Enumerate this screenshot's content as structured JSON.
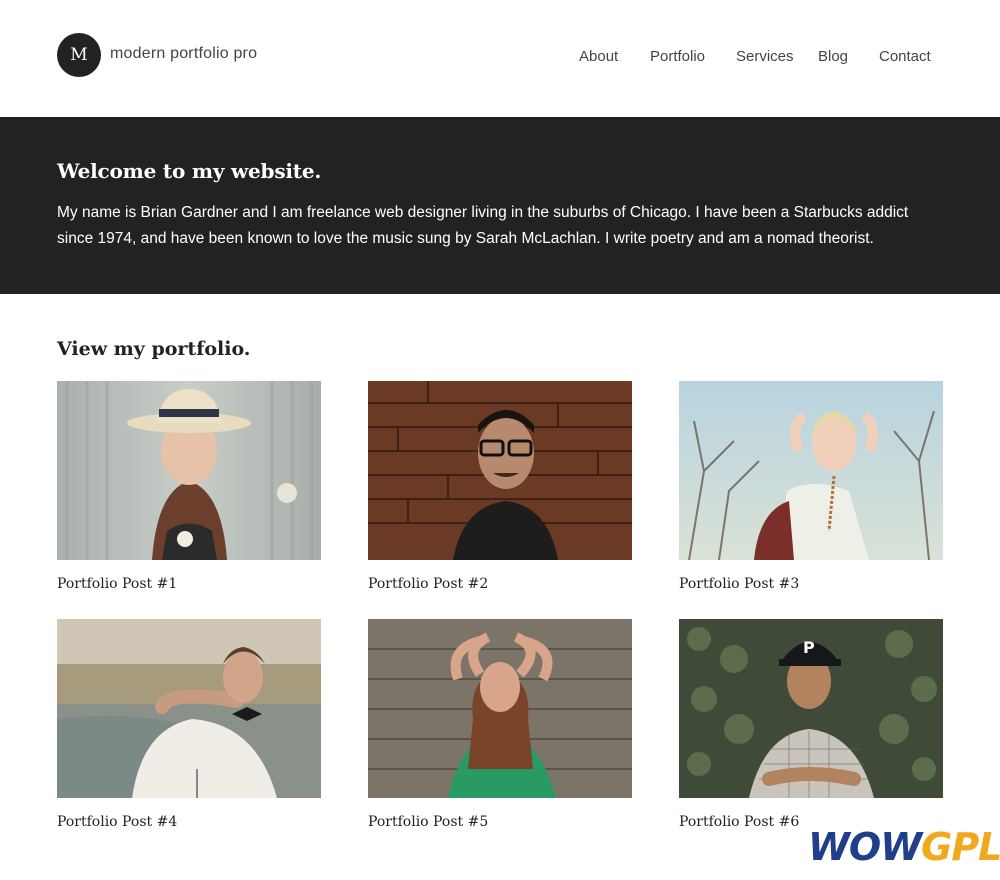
{
  "header": {
    "logo_letter": "M",
    "site_title": "modern portfolio pro",
    "nav": [
      "About",
      "Portfolio",
      "Services",
      "Blog",
      "Contact"
    ]
  },
  "hero": {
    "title": "Welcome to my website.",
    "text": "My name is Brian Gardner and I am freelance web designer living in the suburbs of Chicago. I have been a Starbucks addict since 1974, and have been known to love the music sung by Sarah McLachlan. I write poetry and am a nomad theorist."
  },
  "portfolio": {
    "heading": "View my portfolio.",
    "posts": [
      {
        "title": "Portfolio Post #1"
      },
      {
        "title": "Portfolio Post #2"
      },
      {
        "title": "Portfolio Post #3"
      },
      {
        "title": "Portfolio Post #4"
      },
      {
        "title": "Portfolio Post #5"
      },
      {
        "title": "Portfolio Post #6"
      }
    ]
  },
  "watermark": {
    "part1": "WOW",
    "part2": "GPL",
    "color1": "#1f3f8c",
    "color2": "#f0a81c"
  },
  "colors": {
    "dark_band": "#222222",
    "text": "#222222"
  }
}
